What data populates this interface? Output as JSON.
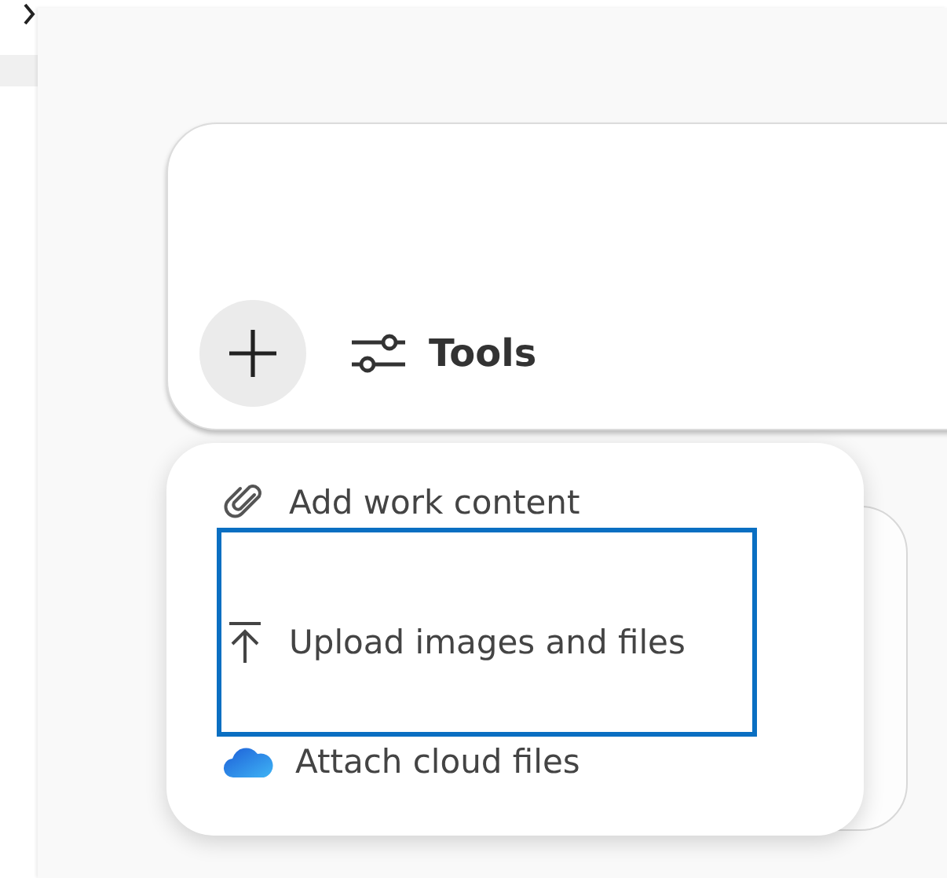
{
  "composer": {
    "tools_label": "Tools"
  },
  "menu": {
    "items": [
      {
        "kind": "paperclip",
        "label": "Add work content",
        "highlighted": false
      },
      {
        "kind": "upload",
        "label": "Upload images and files",
        "highlighted": true
      },
      {
        "kind": "cloud",
        "label": "Attach cloud files",
        "highlighted": false
      }
    ]
  }
}
